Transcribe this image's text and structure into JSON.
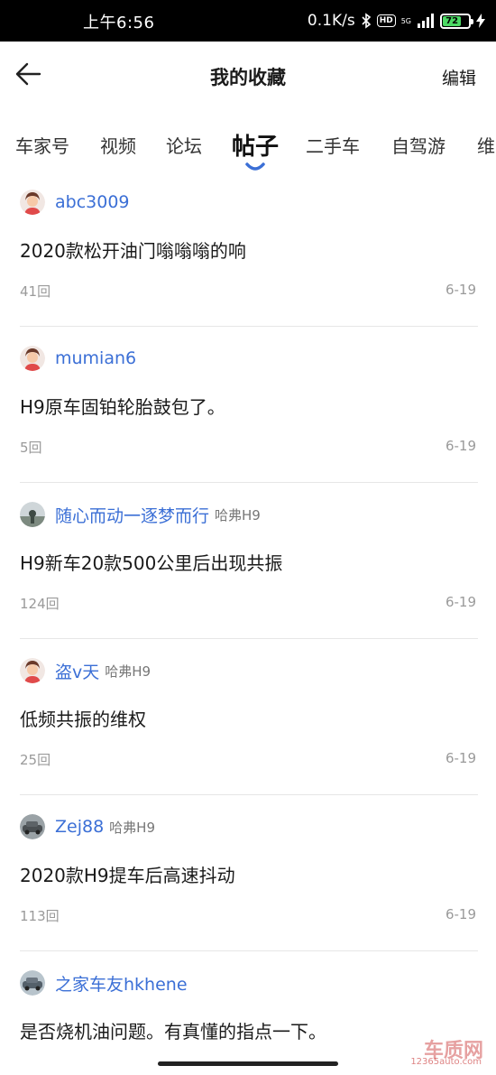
{
  "status_bar": {
    "time": "上午6:56",
    "network_speed": "0.1K/s",
    "bluetooth_icon": "bluetooth-icon",
    "hd_label": "HD",
    "signal_label": "5G",
    "battery_level": "72"
  },
  "header": {
    "back_icon": "arrow-left-icon",
    "title": "我的收藏",
    "edit_label": "编辑"
  },
  "tabs": [
    {
      "label": "车家号"
    },
    {
      "label": "视频"
    },
    {
      "label": "论坛"
    },
    {
      "label": "帖子"
    },
    {
      "label": "二手车"
    },
    {
      "label": "自驾游"
    },
    {
      "label": "维"
    }
  ],
  "active_tab": "帖子",
  "accent_color": "#3b6fd6",
  "posts": [
    {
      "author": "abc3009",
      "tag": "",
      "title": "2020款松开油门嗡嗡嗡的响",
      "replies": "41回",
      "date": "6-19"
    },
    {
      "author": "mumian6",
      "tag": "",
      "title": "H9原车固铂轮胎鼓包了。",
      "replies": "5回",
      "date": "6-19"
    },
    {
      "author": "随心而动一逐梦而行",
      "tag": "哈弗H9",
      "title": "H9新车20款500公里后出现共振",
      "replies": "124回",
      "date": "6-19"
    },
    {
      "author": "盗v天",
      "tag": "哈弗H9",
      "title": "低频共振的维权",
      "replies": "25回",
      "date": "6-19"
    },
    {
      "author": "Zej88",
      "tag": "哈弗H9",
      "title": "2020款H9提车后高速抖动",
      "replies": "113回",
      "date": "6-19"
    },
    {
      "author": "之家车友hkhene",
      "tag": "",
      "title": "是否烧机油问题。有真懂的指点一下。",
      "replies": "",
      "date": ""
    }
  ],
  "watermark": {
    "brand": "车质网",
    "url": "12365auto.com"
  }
}
